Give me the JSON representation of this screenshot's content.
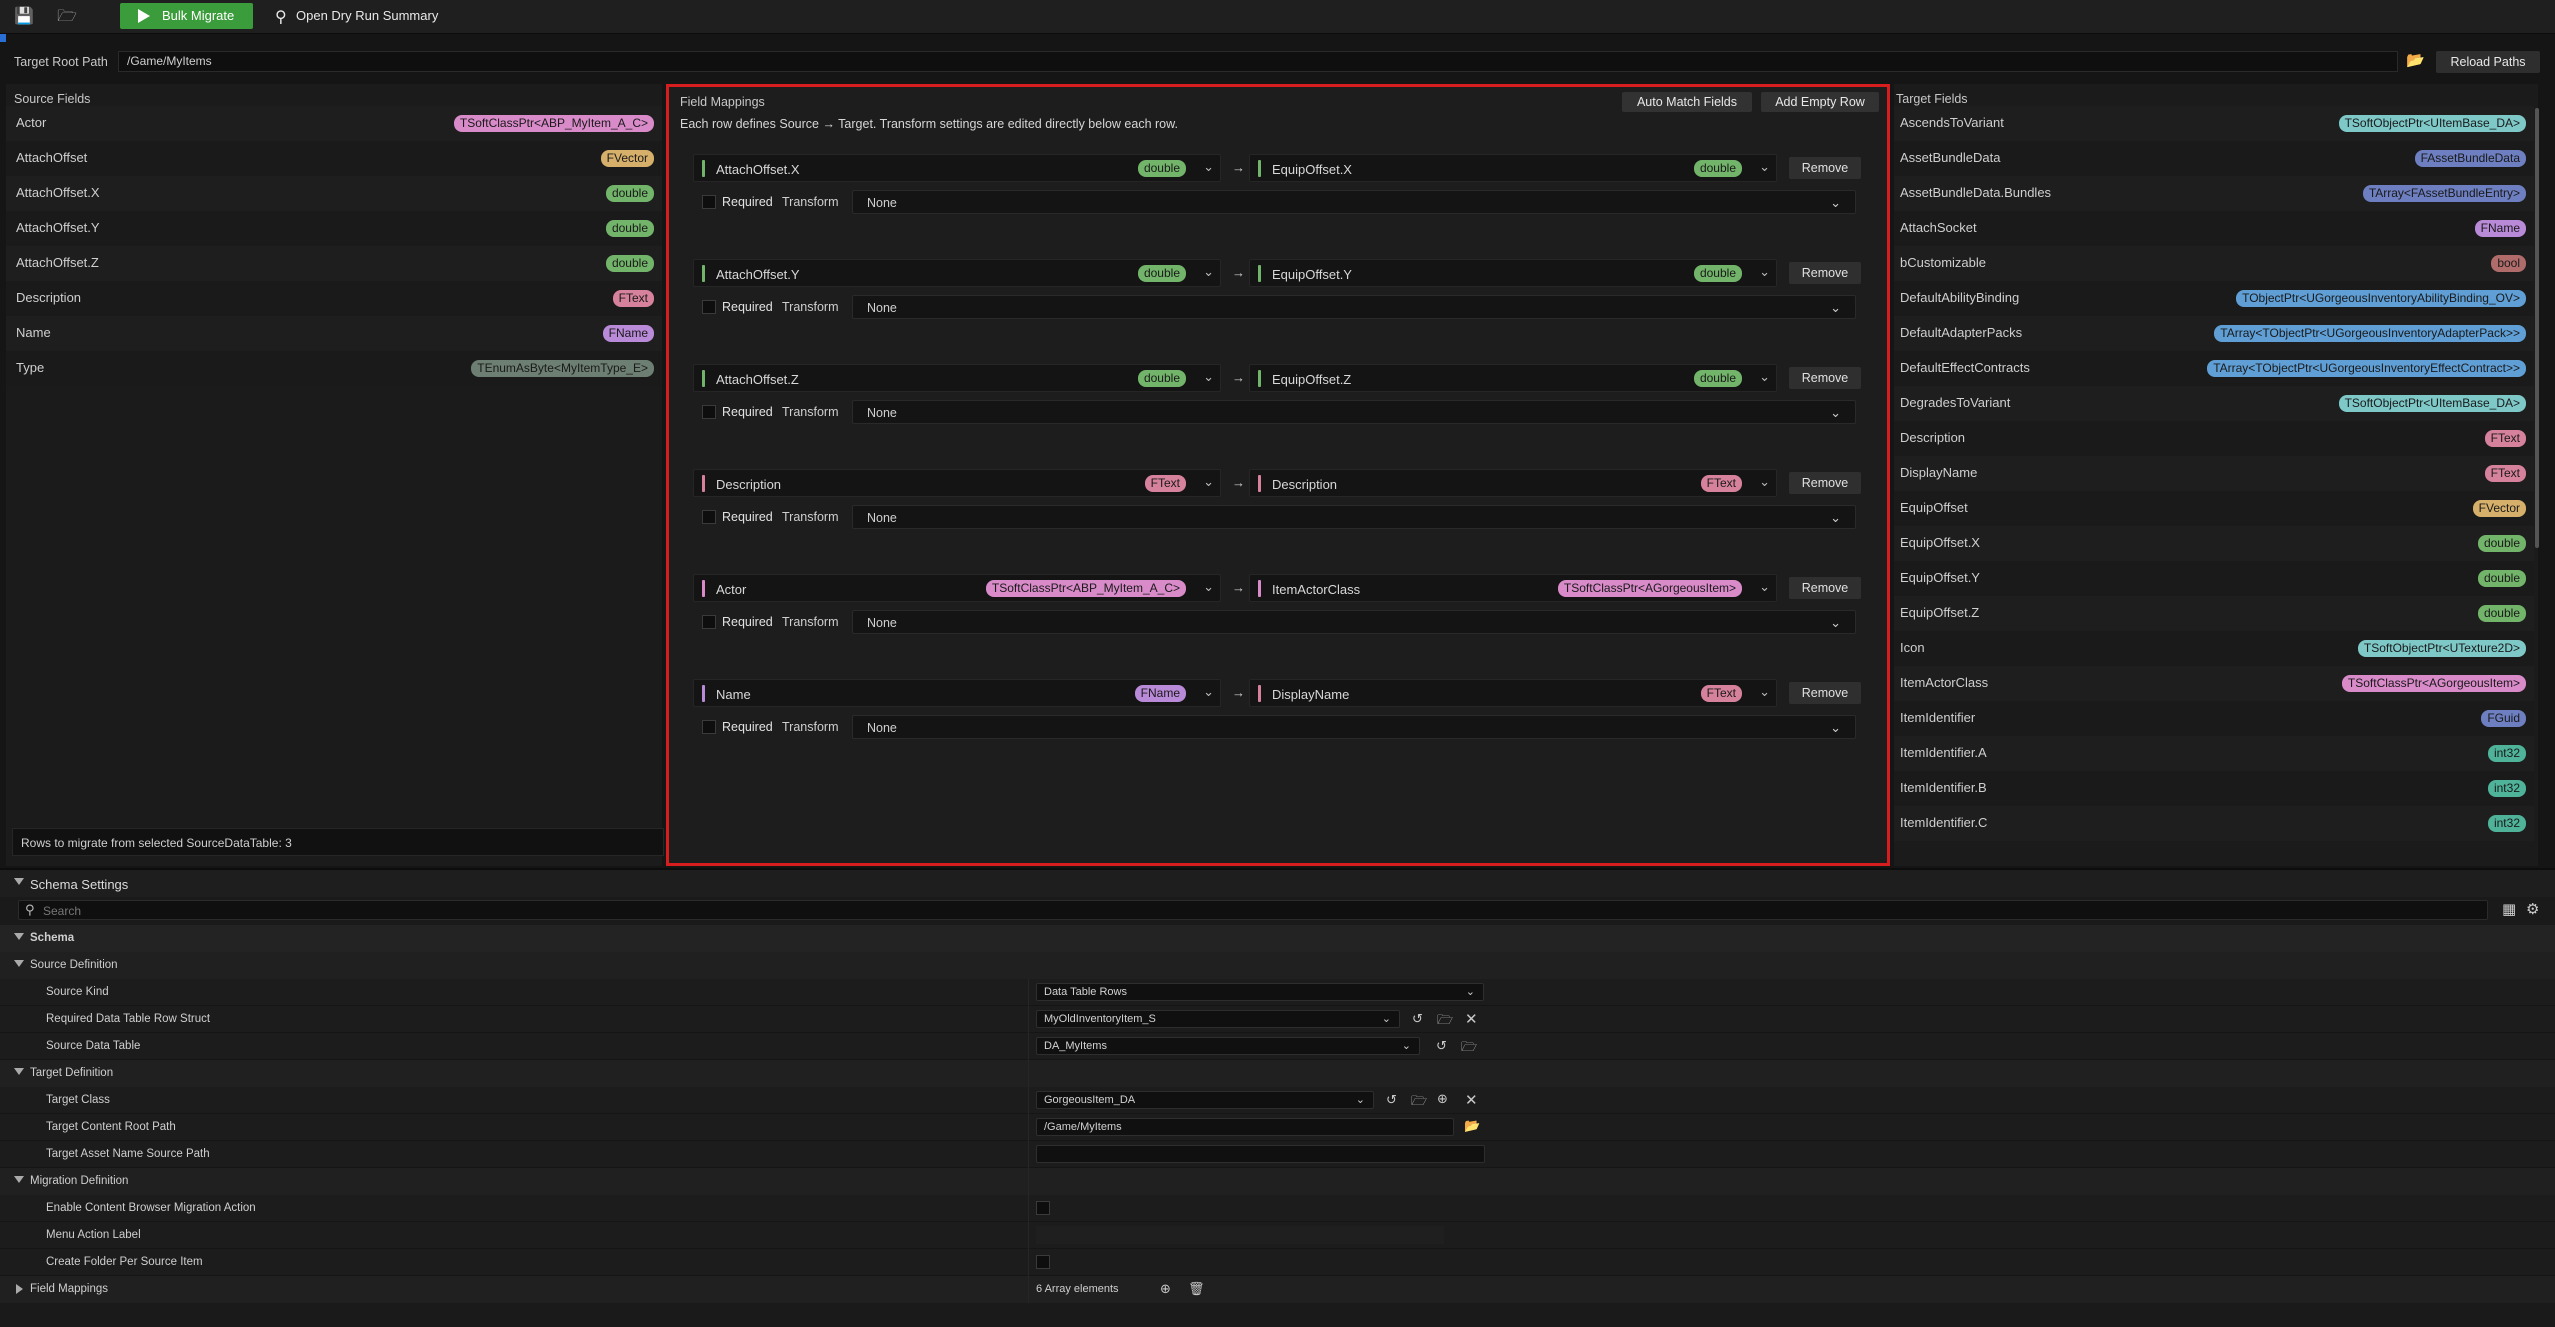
{
  "toolbar": {
    "bulk_migrate": "Bulk Migrate",
    "open_dry_run": "Open Dry Run Summary"
  },
  "root": {
    "label": "Target Root Path",
    "value": "/Game/MyItems",
    "reload": "Reload Paths"
  },
  "source": {
    "title": "Source Fields",
    "fields": [
      {
        "name": "Actor",
        "type": "TSoftClassPtr<ABP_MyItem_A_C>",
        "color": "#d98bc9"
      },
      {
        "name": "AttachOffset",
        "type": "FVector",
        "color": "#d6b06a"
      },
      {
        "name": "AttachOffset.X",
        "type": "double",
        "color": "#72b46a"
      },
      {
        "name": "AttachOffset.Y",
        "type": "double",
        "color": "#72b46a"
      },
      {
        "name": "AttachOffset.Z",
        "type": "double",
        "color": "#72b46a"
      },
      {
        "name": "Description",
        "type": "FText",
        "color": "#d7829d"
      },
      {
        "name": "Name",
        "type": "FName",
        "color": "#b98ad8"
      },
      {
        "name": "Type",
        "type": "TEnumAsByte<MyItemType_E>",
        "color": "#6d7f73"
      }
    ],
    "rows_info": "Rows to migrate from selected SourceDataTable: 3"
  },
  "mappings": {
    "title": "Field Mappings",
    "subtitle": "Each row defines Source → Target. Transform settings are edited directly below each row.",
    "auto_match": "Auto Match Fields",
    "add_empty": "Add Empty Row",
    "remove_label": "Remove",
    "required_label": "Required",
    "transform_label": "Transform",
    "rows": [
      {
        "src": "AttachOffset.X",
        "src_type": "double",
        "src_color": "#72b46a",
        "dst": "EquipOffset.X",
        "dst_type": "double",
        "dst_color": "#72b46a",
        "transform": "None"
      },
      {
        "src": "AttachOffset.Y",
        "src_type": "double",
        "src_color": "#72b46a",
        "dst": "EquipOffset.Y",
        "dst_type": "double",
        "dst_color": "#72b46a",
        "transform": "None"
      },
      {
        "src": "AttachOffset.Z",
        "src_type": "double",
        "src_color": "#72b46a",
        "dst": "EquipOffset.Z",
        "dst_type": "double",
        "dst_color": "#72b46a",
        "transform": "None"
      },
      {
        "src": "Description",
        "src_type": "FText",
        "src_color": "#d7829d",
        "dst": "Description",
        "dst_type": "FText",
        "dst_color": "#d7829d",
        "transform": "None"
      },
      {
        "src": "Actor",
        "src_type": "TSoftClassPtr<ABP_MyItem_A_C>",
        "src_color": "#d98bc9",
        "dst": "ItemActorClass",
        "dst_type": "TSoftClassPtr<AGorgeousItem>",
        "dst_color": "#d98bc9",
        "transform": "None"
      },
      {
        "src": "Name",
        "src_type": "FName",
        "src_color": "#b98ad8",
        "dst": "DisplayName",
        "dst_type": "FText",
        "dst_color": "#d7829d",
        "transform": "None"
      }
    ]
  },
  "target": {
    "title": "Target Fields",
    "fields": [
      {
        "name": "AscendsToVariant",
        "type": "TSoftObjectPtr<UItemBase_DA>",
        "color": "#7fc8c8"
      },
      {
        "name": "AssetBundleData",
        "type": "FAssetBundleData",
        "color": "#6d7fc0"
      },
      {
        "name": "AssetBundleData.Bundles",
        "type": "TArray<FAssetBundleEntry>",
        "color": "#6d7fc0"
      },
      {
        "name": "AttachSocket",
        "type": "FName",
        "color": "#b98ad8"
      },
      {
        "name": "bCustomizable",
        "type": "bool",
        "color": "#b06b6b"
      },
      {
        "name": "DefaultAbilityBinding",
        "type": "TObjectPtr<UGorgeousInventoryAbilityBinding_OV>",
        "color": "#5f9fd6"
      },
      {
        "name": "DefaultAdapterPacks",
        "type": "TArray<TObjectPtr<UGorgeousInventoryAdapterPack>>",
        "color": "#5f9fd6"
      },
      {
        "name": "DefaultEffectContracts",
        "type": "TArray<TObjectPtr<UGorgeousInventoryEffectContract>>",
        "color": "#5f9fd6"
      },
      {
        "name": "DegradesToVariant",
        "type": "TSoftObjectPtr<UItemBase_DA>",
        "color": "#7fc8c8"
      },
      {
        "name": "Description",
        "type": "FText",
        "color": "#d7829d"
      },
      {
        "name": "DisplayName",
        "type": "FText",
        "color": "#d7829d"
      },
      {
        "name": "EquipOffset",
        "type": "FVector",
        "color": "#d6b06a"
      },
      {
        "name": "EquipOffset.X",
        "type": "double",
        "color": "#72b46a"
      },
      {
        "name": "EquipOffset.Y",
        "type": "double",
        "color": "#72b46a"
      },
      {
        "name": "EquipOffset.Z",
        "type": "double",
        "color": "#72b46a"
      },
      {
        "name": "Icon",
        "type": "TSoftObjectPtr<UTexture2D>",
        "color": "#7fc8c8"
      },
      {
        "name": "ItemActorClass",
        "type": "TSoftClassPtr<AGorgeousItem>",
        "color": "#d98bc9"
      },
      {
        "name": "ItemIdentifier",
        "type": "FGuid",
        "color": "#6d7fc0"
      },
      {
        "name": "ItemIdentifier.A",
        "type": "int32",
        "color": "#4fb39a"
      },
      {
        "name": "ItemIdentifier.B",
        "type": "int32",
        "color": "#4fb39a"
      },
      {
        "name": "ItemIdentifier.C",
        "type": "int32",
        "color": "#4fb39a"
      }
    ]
  },
  "schema": {
    "title": "Schema Settings",
    "search_placeholder": "Search",
    "schema_cat": "Schema",
    "source_def": "Source Definition",
    "source_kind_label": "Source Kind",
    "source_kind_value": "Data Table Rows",
    "row_struct_label": "Required Data Table Row Struct",
    "row_struct_value": "MyOldInventoryItem_S",
    "source_table_label": "Source Data Table",
    "source_table_value": "DA_MyItems",
    "target_def": "Target Definition",
    "target_class_label": "Target Class",
    "target_class_value": "GorgeousItem_DA",
    "target_root_label": "Target Content Root Path",
    "target_root_value": "/Game/MyItems",
    "target_asset_label": "Target Asset Name Source Path",
    "target_asset_value": "",
    "migration_def": "Migration Definition",
    "enable_cb_label": "Enable Content Browser Migration Action",
    "menu_label": "Menu Action Label",
    "folder_label": "Create Folder Per Source Item",
    "field_mappings_label": "Field Mappings",
    "field_mappings_value": "6 Array elements"
  }
}
